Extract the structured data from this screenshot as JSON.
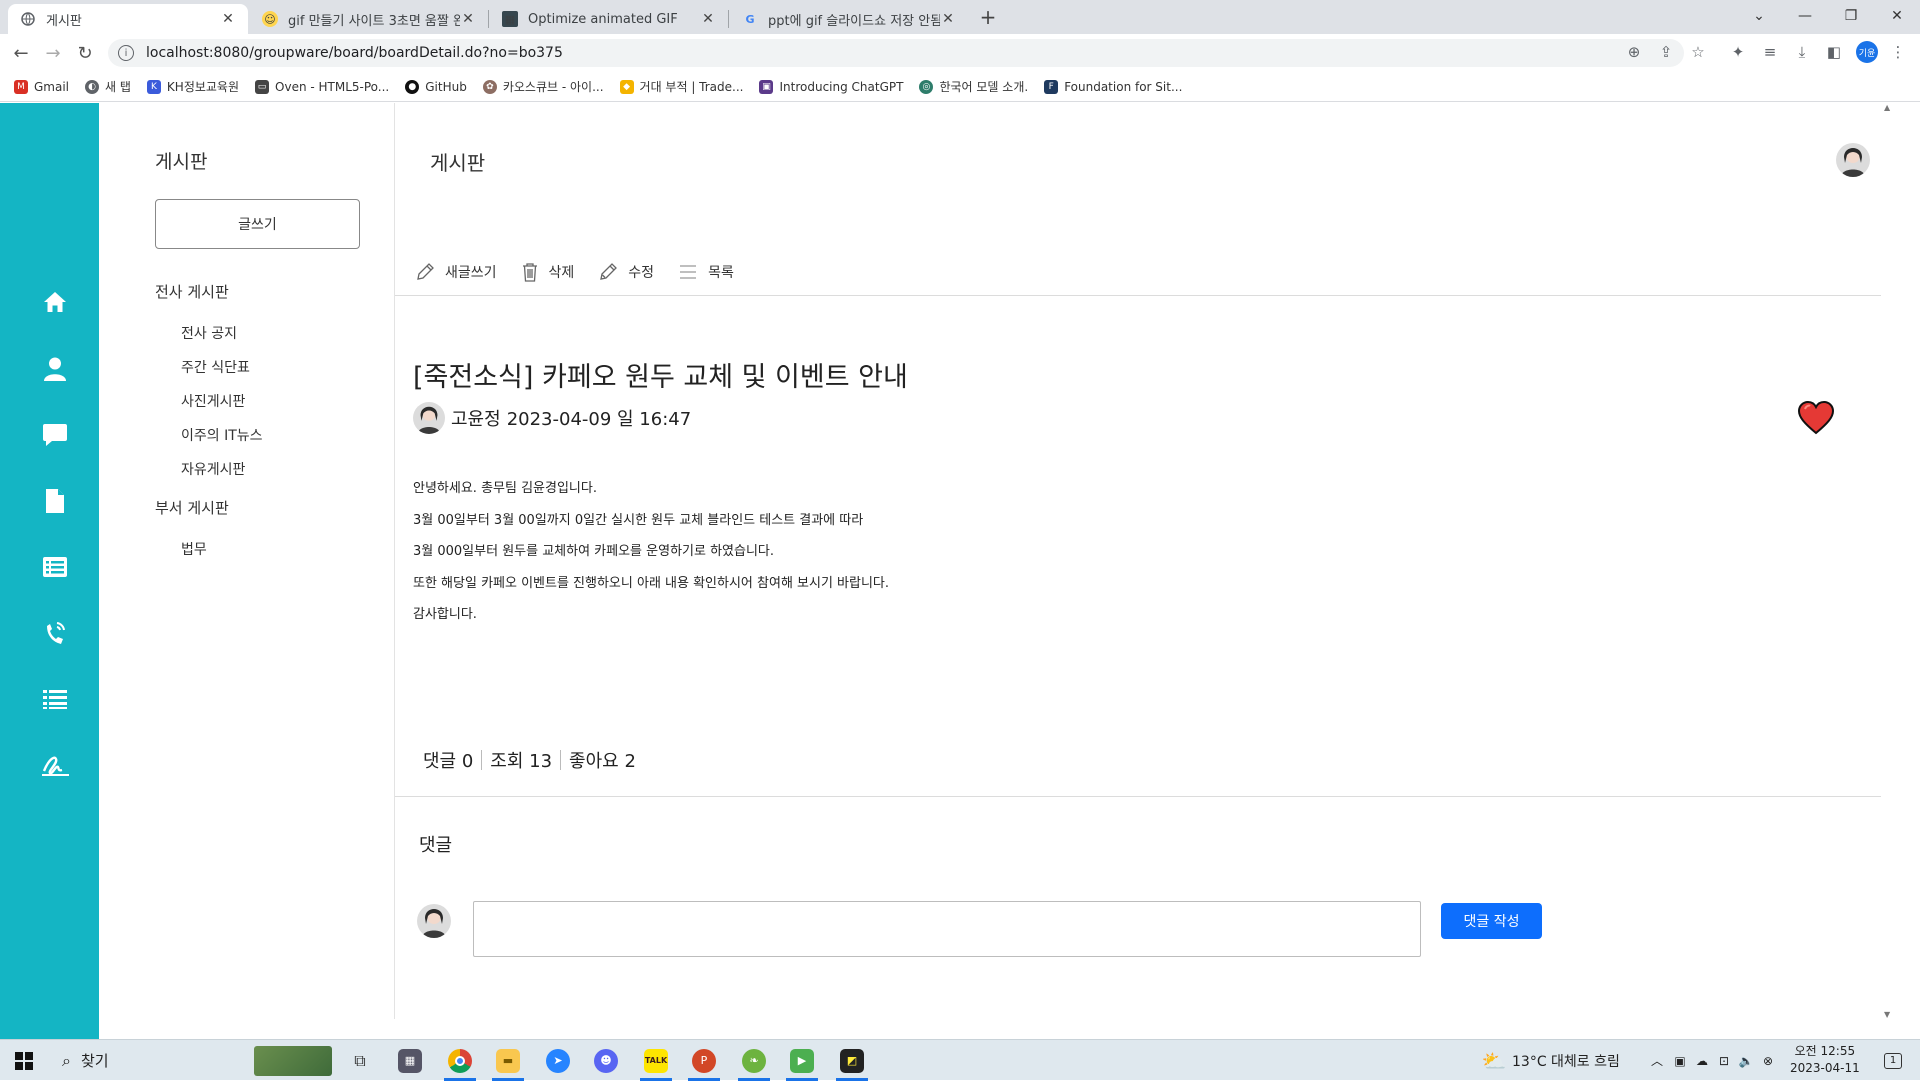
{
  "browser": {
    "tabs": [
      {
        "title": "게시판",
        "active": true
      },
      {
        "title": "gif 만들기 사이트 3초면 움짤 완",
        "active": false
      },
      {
        "title": "Optimize animated GIF",
        "active": false
      },
      {
        "title": "ppt에 gif 슬라이드쇼 저장 안됨",
        "active": false
      }
    ],
    "url": "localhost:8080/groupware/board/boardDetail.do?no=bo375",
    "profile_initials": "기윤",
    "bookmarks": [
      {
        "label": "Gmail",
        "icon": "gmail-icon",
        "color": "#d93025"
      },
      {
        "label": "새 탭",
        "icon": "newtab-icon",
        "color": "#5f6368"
      },
      {
        "label": "KH정보교육원",
        "icon": "kh-icon",
        "color": "#3b5bdb"
      },
      {
        "label": "Oven - HTML5-Po...",
        "icon": "oven-icon",
        "color": "#444444"
      },
      {
        "label": "GitHub",
        "icon": "github-icon",
        "color": "#111111"
      },
      {
        "label": "카오스큐브 - 아이...",
        "icon": "chaos-icon",
        "color": "#8d6e63"
      },
      {
        "label": "거대 부적 | Trade...",
        "icon": "trade-icon",
        "color": "#f4b400"
      },
      {
        "label": "Introducing ChatGPT",
        "icon": "openai-icon",
        "color": "#5b3a8a"
      },
      {
        "label": "한국어 모델 소개.",
        "icon": "model-icon",
        "color": "#2e7d6b"
      },
      {
        "label": "Foundation for Sit...",
        "icon": "foundation-icon",
        "color": "#1f3a5f"
      }
    ]
  },
  "sidenav": {
    "title": "게시판",
    "write_button": "글쓰기",
    "groups": [
      {
        "label": "전사 게시판",
        "items": [
          "전사 공지",
          "주간 식단표",
          "사진게시판",
          "이주의 IT뉴스",
          "자유게시판"
        ]
      },
      {
        "label": "부서 게시판",
        "items": [
          "법무"
        ]
      }
    ]
  },
  "main": {
    "page_title": "게시판",
    "toolbar": {
      "new": "새글쓰기",
      "delete": "삭제",
      "edit": "수정",
      "list": "목록"
    },
    "post": {
      "title": "[죽전소식] 카페오 원두 교체 및 이벤트 안내",
      "author": "고윤정",
      "datetime": "2023-04-09 일 16:47",
      "body": [
        "안녕하세요. 총무팀 김윤경입니다.",
        "3월 00일부터 3월 00일까지 0일간 실시한 원두 교체 블라인드 테스트 결과에 따라",
        "3월 000일부터 원두를 교체하여 카페오를 운영하기로 하였습니다.",
        "또한 해당일 카페오 이벤트를 진행하오니 아래 내용 확인하시어 참여해 보시기 바랍니다.",
        "감사합니다."
      ]
    },
    "stats": {
      "comments": "댓글 0",
      "views": "조회 13",
      "likes": "좋아요 2"
    },
    "comment_section": {
      "title": "댓글",
      "input_value": "",
      "submit": "댓글 작성"
    }
  },
  "taskbar": {
    "search": "찾기",
    "weather": "13°C  대체로 흐림",
    "time": "오전 12:55",
    "date": "2023-04-11",
    "notification_count": "1"
  },
  "colors": {
    "sidebar": "#14b5c4",
    "primary_button": "#0d6efd",
    "heart": "#e53935"
  }
}
